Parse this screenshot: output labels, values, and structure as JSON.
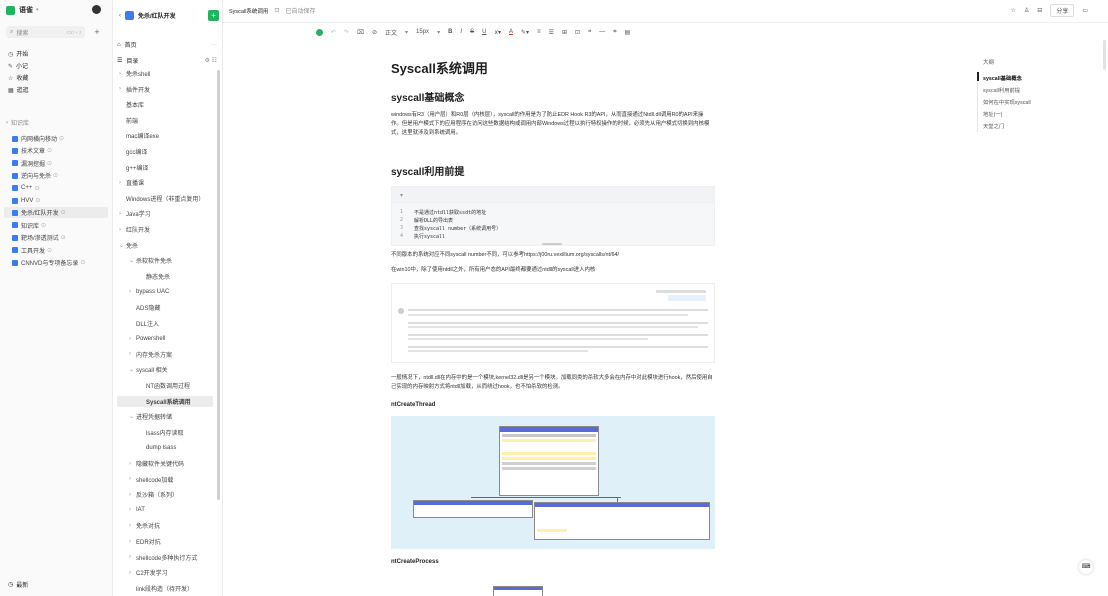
{
  "nav": {
    "app_name": "语雀",
    "search_placeholder": "搜索",
    "search_shortcut": "Ctrl + J",
    "menu": [
      {
        "icon": "home-icon",
        "label": "开始"
      },
      {
        "icon": "pen-icon",
        "label": "小记"
      },
      {
        "icon": "star-icon",
        "label": "收藏"
      },
      {
        "icon": "grid-icon",
        "label": "逛逛"
      }
    ],
    "section_label": "知识库",
    "repos": [
      "内网横向移动",
      "技术文章",
      "漏洞挖掘",
      "逆向与免杀",
      "C++",
      "HVV",
      "免杀/红队开发",
      "知识库",
      "靶场/渗透测试",
      "工具开发",
      "CNNVD与专项备忘录"
    ],
    "selected_repo_index": 6,
    "bottom_label": "最新"
  },
  "dir": {
    "repo_title": "免杀/红队开发",
    "home_label": "首页",
    "toc_label": "目录",
    "items": [
      {
        "t": "免杀shell",
        "d": 0,
        "c": 1
      },
      {
        "t": "插件开发",
        "d": 0,
        "c": 1
      },
      {
        "t": "基本库",
        "d": 0
      },
      {
        "t": "前端",
        "d": 0
      },
      {
        "t": "mac编译exe",
        "d": 0
      },
      {
        "t": "gcc编译",
        "d": 0
      },
      {
        "t": "g++编译",
        "d": 0
      },
      {
        "t": "直播课",
        "d": 0,
        "c": 1
      },
      {
        "t": "Windows进程（非重点复用）",
        "d": 0
      },
      {
        "t": "Java学习",
        "d": 0,
        "c": 1
      },
      {
        "t": "红队开发",
        "d": 0,
        "c": 1
      },
      {
        "t": "免杀",
        "d": 0,
        "c": 2
      },
      {
        "t": "杀软软件免杀",
        "d": 1,
        "c": 2
      },
      {
        "t": "静态免杀",
        "d": 2
      },
      {
        "t": "bypass UAC",
        "d": 1,
        "c": 1
      },
      {
        "t": "ADS隐藏",
        "d": 1
      },
      {
        "t": "DLL注入",
        "d": 1
      },
      {
        "t": "Powershell",
        "d": 1,
        "c": 1
      },
      {
        "t": "内存免杀方案",
        "d": 1,
        "c": 1
      },
      {
        "t": "syscall 相关",
        "d": 1,
        "c": 2
      },
      {
        "t": "NT函数调用过程",
        "d": 2
      },
      {
        "t": "Syscall系统调用",
        "d": 2,
        "sel": 1
      },
      {
        "t": "进程凭据转储",
        "d": 1,
        "c": 2
      },
      {
        "t": "lsass内存读取",
        "d": 2
      },
      {
        "t": "dump lsass",
        "d": 2
      },
      {
        "t": "隐藏软件关键代码",
        "d": 1,
        "c": 1
      },
      {
        "t": "shellcode加载",
        "d": 1,
        "c": 1
      },
      {
        "t": "反沙箱（系列）",
        "d": 1,
        "c": 1
      },
      {
        "t": "IAT",
        "d": 1,
        "c": 1
      },
      {
        "t": "免杀对抗",
        "d": 1,
        "c": 1
      },
      {
        "t": "EDR对抗",
        "d": 1,
        "c": 1
      },
      {
        "t": "shellcode多种执行方式",
        "d": 1,
        "c": 1
      },
      {
        "t": "C2开发学习",
        "d": 1,
        "c": 1
      },
      {
        "t": "link段构造（待开发）",
        "d": 1
      }
    ]
  },
  "topbar": {
    "breadcrumb": "Syscall系统调用",
    "status": "已自动保存",
    "share_label": "分享"
  },
  "toolbar": {
    "text_style": "正文",
    "font_size": "15px",
    "items": [
      "B",
      "I",
      "S",
      "U",
      "A",
      "≡",
      "☰",
      "⊞",
      "⊡",
      "❝",
      "—"
    ]
  },
  "doc": {
    "title": "Syscall系统调用",
    "h_concept": "syscall基础概念",
    "p_concept": "windows有R3（用户层）和R0层（内核层），syscall的作用是为了防止EDR Hook R3的API，从而直接通过Ntdll.dll调用R0的API来操作。但是用户模式下的应用程序在访问这些数据结构或调用内部Windows过程以执行特权操作的时候，必须先从用户模式切换到内核模式，这里就涉及到系统调用。",
    "h_prereq": "syscall利用前提",
    "code_lines": [
      "不是通过ntdll获取ssdt的地址",
      "解析DLL的导出表",
      "查找syscall number（系统调用号）",
      "执行syscall"
    ],
    "p_link": "不同版本的系统对应不同syscall number不同，可以参考https://j00ru.vexillium.org/syscalls/nt/64/",
    "p_win10": "在win10中，除了使用ntdll之外，所有用户态的API最终都要通过ntdll的syscall进入内核",
    "p_normal": "一般情况下，ntdll.dll在内存中的是一个模块,kernel32.dll是另一个模块。加载同类的杀软大多会在内存中对此模块进行hook，然后使用自己实现的内存映射方式将ntdll加载，从而绕过hook，也不怕杀软的检测。",
    "h_create_thread": "ntCreateThread",
    "h_create_process": "ntCreateProcess"
  },
  "outline": {
    "title": "大纲",
    "items": [
      "syscall基础概念",
      "syscall利用前提",
      "如何在中实现syscall",
      "地址(一)",
      "天堂之门"
    ],
    "active_index": 0
  }
}
